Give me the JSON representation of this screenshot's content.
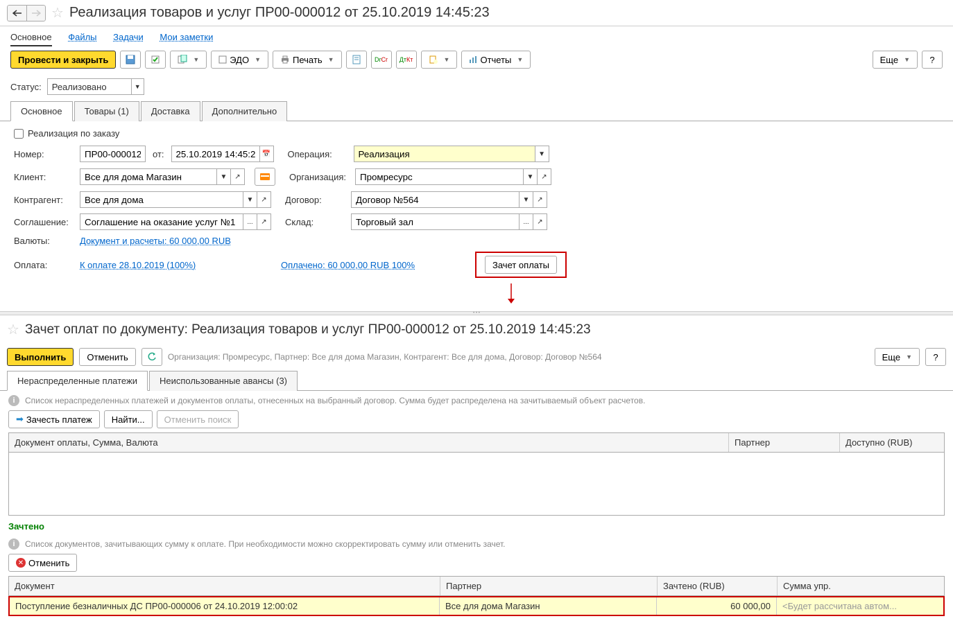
{
  "header": {
    "title": "Реализация товаров и услуг ПР00-000012 от 25.10.2019 14:45:23"
  },
  "navTabs": {
    "main": "Основное",
    "files": "Файлы",
    "tasks": "Задачи",
    "notes": "Мои заметки"
  },
  "toolbar": {
    "postAndClose": "Провести и закрыть",
    "edo": "ЭДО",
    "print": "Печать",
    "reports": "Отчеты",
    "more": "Еще"
  },
  "status": {
    "label": "Статус:",
    "value": "Реализовано"
  },
  "formTabs": {
    "main": "Основное",
    "goods": "Товары (1)",
    "delivery": "Доставка",
    "additional": "Дополнительно"
  },
  "form": {
    "byOrder": "Реализация по заказу",
    "numberLabel": "Номер:",
    "numberValue": "ПР00-000012",
    "fromLabel": "от:",
    "dateValue": "25.10.2019 14:45:23",
    "operationLabel": "Операция:",
    "operationValue": "Реализация",
    "clientLabel": "Клиент:",
    "clientValue": "Все для дома Магазин",
    "orgLabel": "Организация:",
    "orgValue": "Промресурс",
    "counterpartyLabel": "Контрагент:",
    "counterpartyValue": "Все для дома",
    "contractLabel": "Договор:",
    "contractValue": "Договор №564",
    "agreementLabel": "Соглашение:",
    "agreementValue": "Соглашение на оказание услуг №1",
    "warehouseLabel": "Склад:",
    "warehouseValue": "Торговый зал",
    "currencyLabel": "Валюты:",
    "currencyLink": "Документ и расчеты: 60 000,00 RUB",
    "paymentLabel": "Оплата:",
    "paymentLink": "К оплате 28.10.2019 (100%)",
    "paidLink": "Оплачено: 60 000,00 RUB  100%",
    "offsetBtn": "Зачет оплаты"
  },
  "section2": {
    "title": "Зачет оплат по документу: Реализация товаров и услуг ПР00-000012 от 25.10.2019 14:45:23",
    "execute": "Выполнить",
    "cancel": "Отменить",
    "info": "Организация: Промресурс, Партнер: Все для дома Магазин, Контрагент: Все для дома, Договор: Договор №564",
    "more": "Еще",
    "tab1": "Нераспределенные платежи",
    "tab2": "Неиспользованные авансы (3)",
    "hint1": "Список нераспределенных платежей и документов оплаты, отнесенных на выбранный договор. Сумма будет распределена на зачитываемый объект расчетов.",
    "offsetPayment": "Зачесть платеж",
    "find": "Найти...",
    "cancelSearch": "Отменить поиск",
    "col1": "Документ оплаты, Сумма, Валюта",
    "col2": "Партнер",
    "col3": "Доступно (RUB)",
    "credited": "Зачтено",
    "hint2": "Список документов, зачитывающих сумму к оплате. При необходимости можно скорректировать сумму или отменить зачет.",
    "cancelBtn": "Отменить",
    "bcol1": "Документ",
    "bcol2": "Партнер",
    "bcol3": "Зачтено (RUB)",
    "bcol4": "Сумма упр.",
    "row1doc": "Поступление безналичных ДС ПР00-000006 от 24.10.2019 12:00:02",
    "row1partner": "Все для дома Магазин",
    "row1amount": "60 000,00",
    "row1placeholder": "<Будет рассчитана автом..."
  }
}
